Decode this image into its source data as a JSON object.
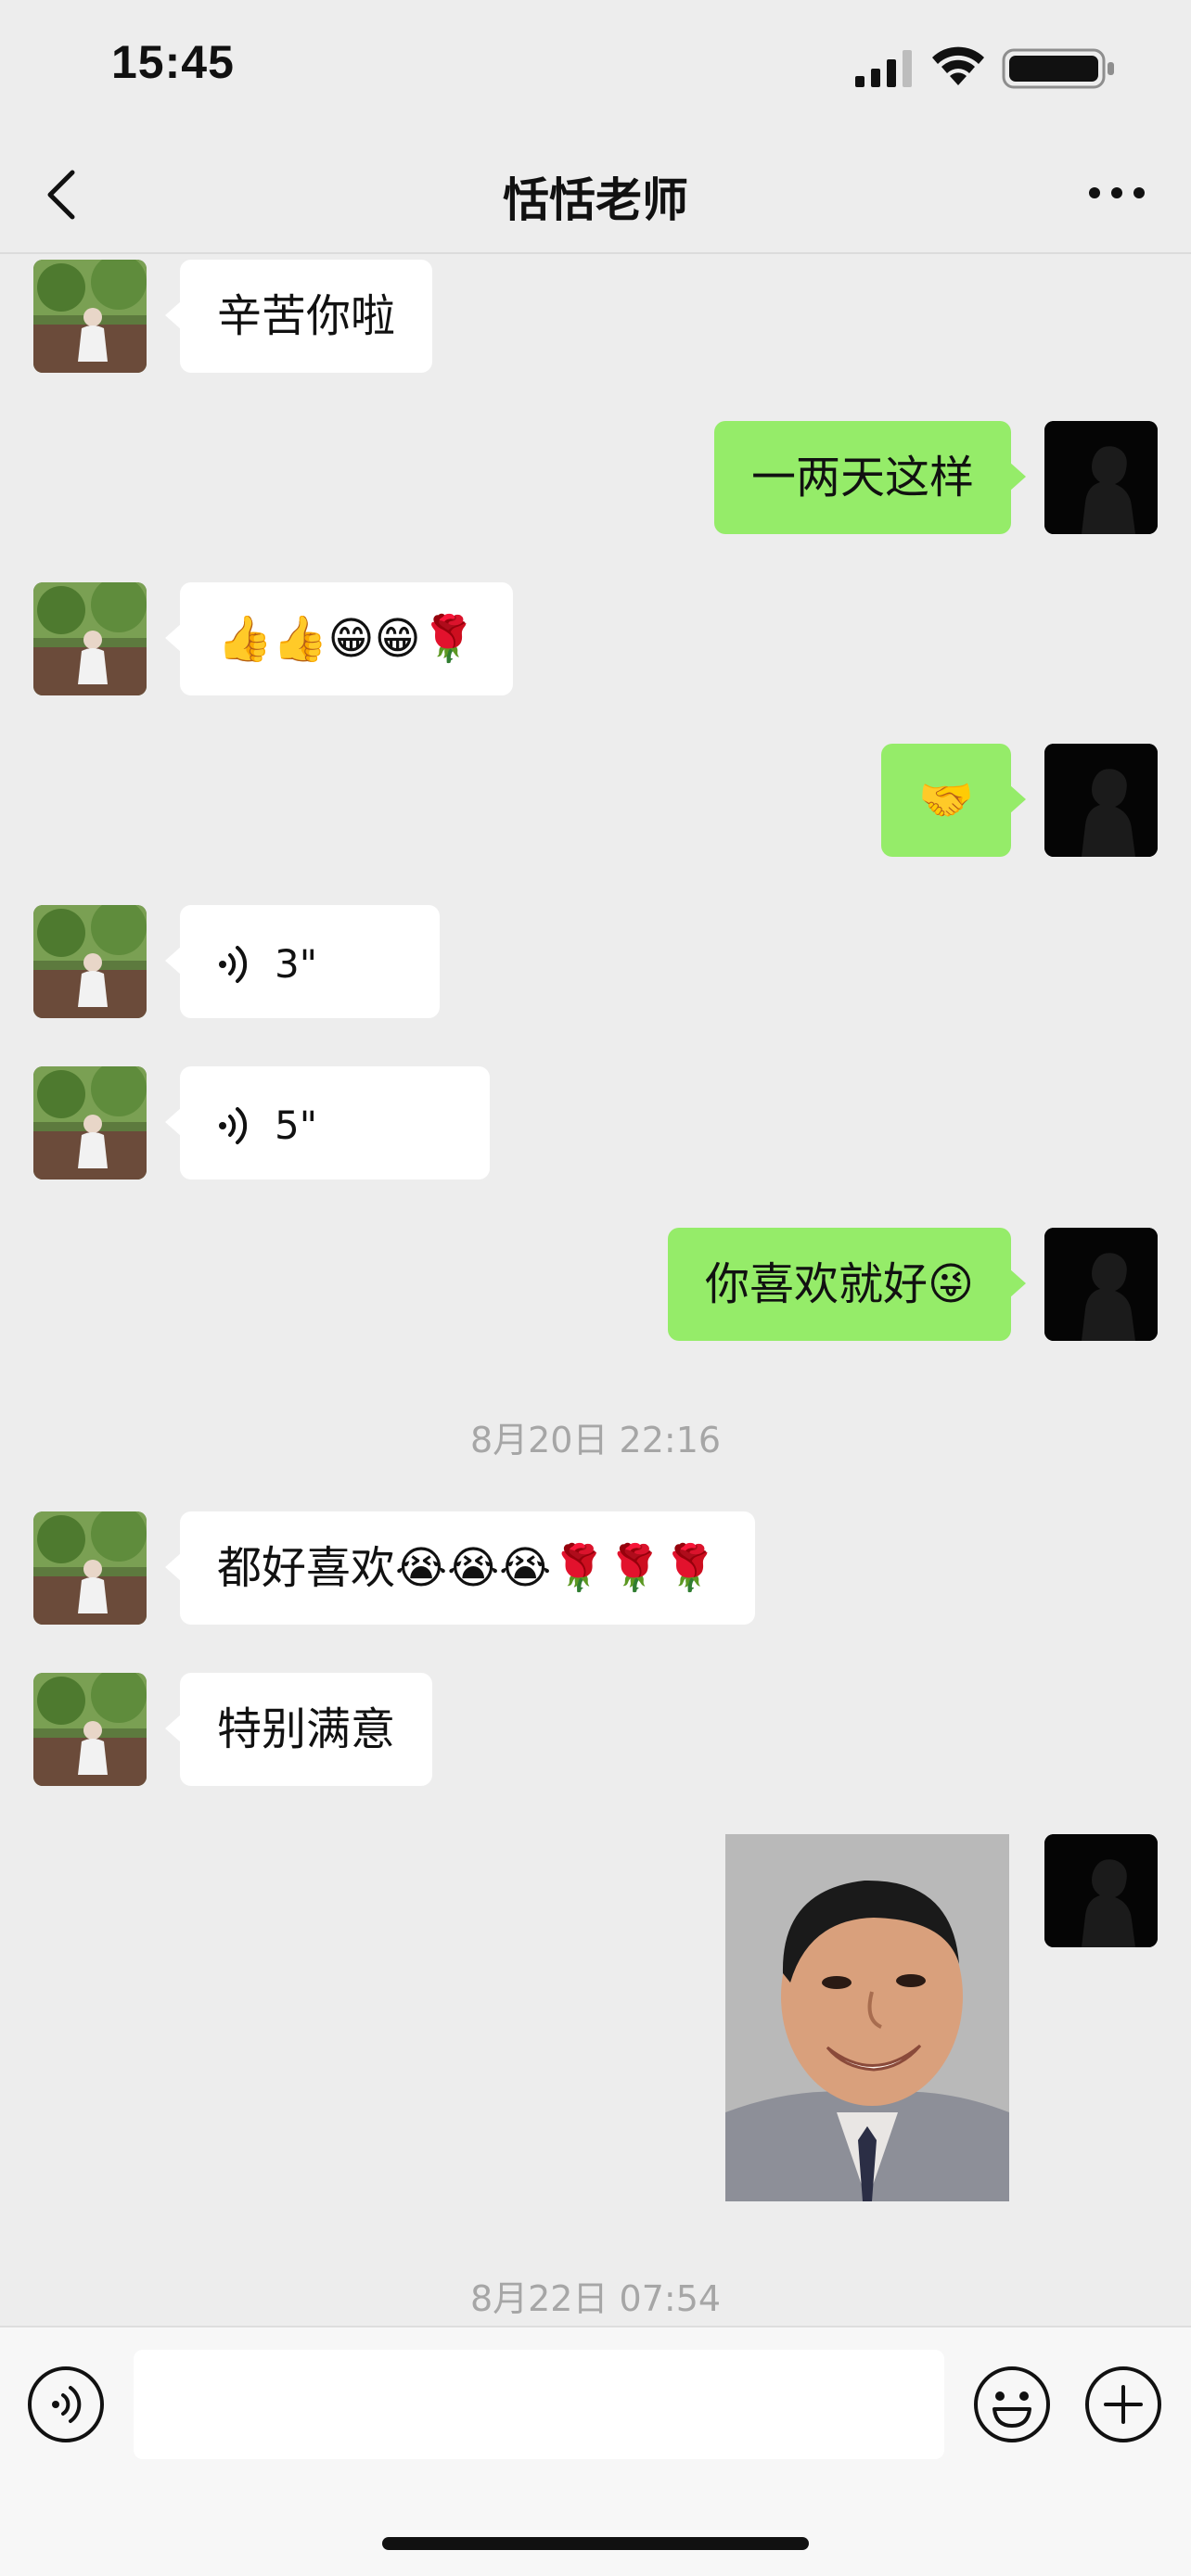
{
  "status_bar": {
    "time": "15:45",
    "icons": [
      "signal-icon",
      "wifi-icon",
      "battery-icon"
    ]
  },
  "nav": {
    "title": "恬恬老师",
    "back_icon": "chevron-left-icon",
    "more_icon": "more-icon"
  },
  "messages": [
    {
      "side": "in",
      "type": "text",
      "text": "辛苦你啦"
    },
    {
      "side": "out",
      "type": "text",
      "text": "一两天这样"
    },
    {
      "side": "in",
      "type": "text",
      "text": "👍👍😁😁🌹"
    },
    {
      "side": "out",
      "type": "text",
      "text": "🤝"
    },
    {
      "side": "in",
      "type": "voice",
      "duration": "3\""
    },
    {
      "side": "in",
      "type": "voice",
      "duration": "5\""
    },
    {
      "side": "out",
      "type": "text",
      "text": "你喜欢就好😜"
    },
    {
      "type": "time",
      "text": "8月20日 22:16"
    },
    {
      "side": "in",
      "type": "text",
      "text": "都好喜欢😭😭😭🌹🌹🌹"
    },
    {
      "side": "in",
      "type": "text",
      "text": "特别满意"
    },
    {
      "side": "out",
      "type": "sticker",
      "sticker": "smiling-man-sticker"
    },
    {
      "type": "time",
      "text": "8月22日 07:54"
    }
  ],
  "input_bar": {
    "placeholder": "",
    "voice_icon": "voice-icon",
    "emoji_icon": "emoji-icon",
    "plus_icon": "plus-icon"
  },
  "colors": {
    "background": "#ededed",
    "outgoing_bubble": "#95ec69",
    "incoming_bubble": "#ffffff",
    "timestamp": "#a6a6a6"
  }
}
